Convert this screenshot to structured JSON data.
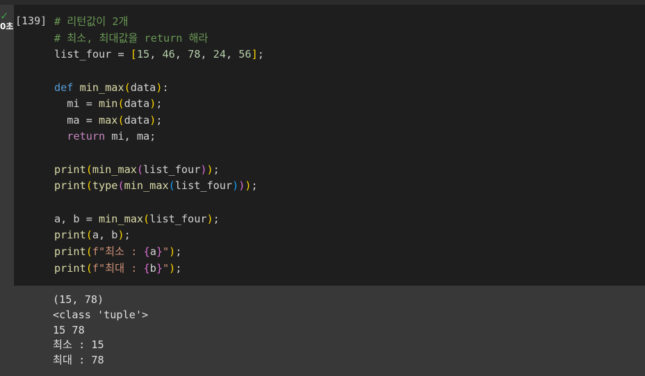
{
  "cell": {
    "status_icon": "check-icon",
    "exec_time": "0초",
    "exec_count": "[139]",
    "code_lines": [
      [
        {
          "t": "# 리턴값이 2개",
          "c": "cm"
        }
      ],
      [
        {
          "t": "# 최소, 최대값을 return 해라",
          "c": "cm"
        }
      ],
      [
        {
          "t": "list_four ",
          "c": "var"
        },
        {
          "t": "= ",
          "c": "var"
        },
        {
          "t": "[",
          "c": "b1"
        },
        {
          "t": "15",
          "c": "num"
        },
        {
          "t": ", ",
          "c": "var"
        },
        {
          "t": "46",
          "c": "num"
        },
        {
          "t": ", ",
          "c": "var"
        },
        {
          "t": "78",
          "c": "num"
        },
        {
          "t": ", ",
          "c": "var"
        },
        {
          "t": "24",
          "c": "num"
        },
        {
          "t": ", ",
          "c": "var"
        },
        {
          "t": "56",
          "c": "num"
        },
        {
          "t": "]",
          "c": "b1"
        },
        {
          "t": ";",
          "c": "var"
        }
      ],
      [],
      [
        {
          "t": "def ",
          "c": "kw"
        },
        {
          "t": "min_max",
          "c": "fn"
        },
        {
          "t": "(",
          "c": "b1"
        },
        {
          "t": "data",
          "c": "var"
        },
        {
          "t": ")",
          "c": "b1"
        },
        {
          "t": ":",
          "c": "var"
        }
      ],
      [
        {
          "t": "  mi ",
          "c": "var"
        },
        {
          "t": "= ",
          "c": "var"
        },
        {
          "t": "min",
          "c": "bi"
        },
        {
          "t": "(",
          "c": "b1"
        },
        {
          "t": "data",
          "c": "var"
        },
        {
          "t": ")",
          "c": "b1"
        },
        {
          "t": ";",
          "c": "var"
        }
      ],
      [
        {
          "t": "  ma ",
          "c": "var"
        },
        {
          "t": "= ",
          "c": "var"
        },
        {
          "t": "max",
          "c": "bi"
        },
        {
          "t": "(",
          "c": "b1"
        },
        {
          "t": "data",
          "c": "var"
        },
        {
          "t": ")",
          "c": "b1"
        },
        {
          "t": ";",
          "c": "var"
        }
      ],
      [
        {
          "t": "  ",
          "c": "var"
        },
        {
          "t": "return ",
          "c": "ctl"
        },
        {
          "t": "mi, ma;",
          "c": "var"
        }
      ],
      [],
      [
        {
          "t": "print",
          "c": "bi"
        },
        {
          "t": "(",
          "c": "b1"
        },
        {
          "t": "min_max",
          "c": "fn"
        },
        {
          "t": "(",
          "c": "b2"
        },
        {
          "t": "list_four",
          "c": "var"
        },
        {
          "t": ")",
          "c": "b2"
        },
        {
          "t": ")",
          "c": "b1"
        },
        {
          "t": ";",
          "c": "var"
        }
      ],
      [
        {
          "t": "print",
          "c": "bi"
        },
        {
          "t": "(",
          "c": "b1"
        },
        {
          "t": "type",
          "c": "bi"
        },
        {
          "t": "(",
          "c": "b2"
        },
        {
          "t": "min_max",
          "c": "fn"
        },
        {
          "t": "(",
          "c": "b3"
        },
        {
          "t": "list_four",
          "c": "var"
        },
        {
          "t": ")",
          "c": "b3"
        },
        {
          "t": ")",
          "c": "b2"
        },
        {
          "t": ")",
          "c": "b1"
        },
        {
          "t": ";",
          "c": "var"
        }
      ],
      [],
      [
        {
          "t": "a, b ",
          "c": "var"
        },
        {
          "t": "= ",
          "c": "var"
        },
        {
          "t": "min_max",
          "c": "fn"
        },
        {
          "t": "(",
          "c": "b1"
        },
        {
          "t": "list_four",
          "c": "var"
        },
        {
          "t": ")",
          "c": "b1"
        },
        {
          "t": ";",
          "c": "var"
        }
      ],
      [
        {
          "t": "print",
          "c": "bi"
        },
        {
          "t": "(",
          "c": "b1"
        },
        {
          "t": "a, b",
          "c": "var"
        },
        {
          "t": ")",
          "c": "b1"
        },
        {
          "t": ";",
          "c": "var"
        }
      ],
      [
        {
          "t": "print",
          "c": "bi"
        },
        {
          "t": "(",
          "c": "b1"
        },
        {
          "t": "f\"최소 : ",
          "c": "str"
        },
        {
          "t": "{",
          "c": "b2"
        },
        {
          "t": "a",
          "c": "var"
        },
        {
          "t": "}",
          "c": "b2"
        },
        {
          "t": "\"",
          "c": "str"
        },
        {
          "t": ")",
          "c": "b1"
        },
        {
          "t": ";",
          "c": "var"
        }
      ],
      [
        {
          "t": "print",
          "c": "bi"
        },
        {
          "t": "(",
          "c": "b1"
        },
        {
          "t": "f\"최대 : ",
          "c": "str"
        },
        {
          "t": "{",
          "c": "b2"
        },
        {
          "t": "b",
          "c": "var"
        },
        {
          "t": "}",
          "c": "b2"
        },
        {
          "t": "\"",
          "c": "str"
        },
        {
          "t": ")",
          "c": "b1"
        },
        {
          "t": ";",
          "c": "var"
        }
      ]
    ],
    "output_lines": [
      "(15, 78)",
      "<class 'tuple'>",
      "15 78",
      "최소 : 15",
      "최대 : 78"
    ]
  },
  "colors": {
    "background": "#383838",
    "cell_background": "#1e1e1e",
    "success": "#3fa045"
  }
}
